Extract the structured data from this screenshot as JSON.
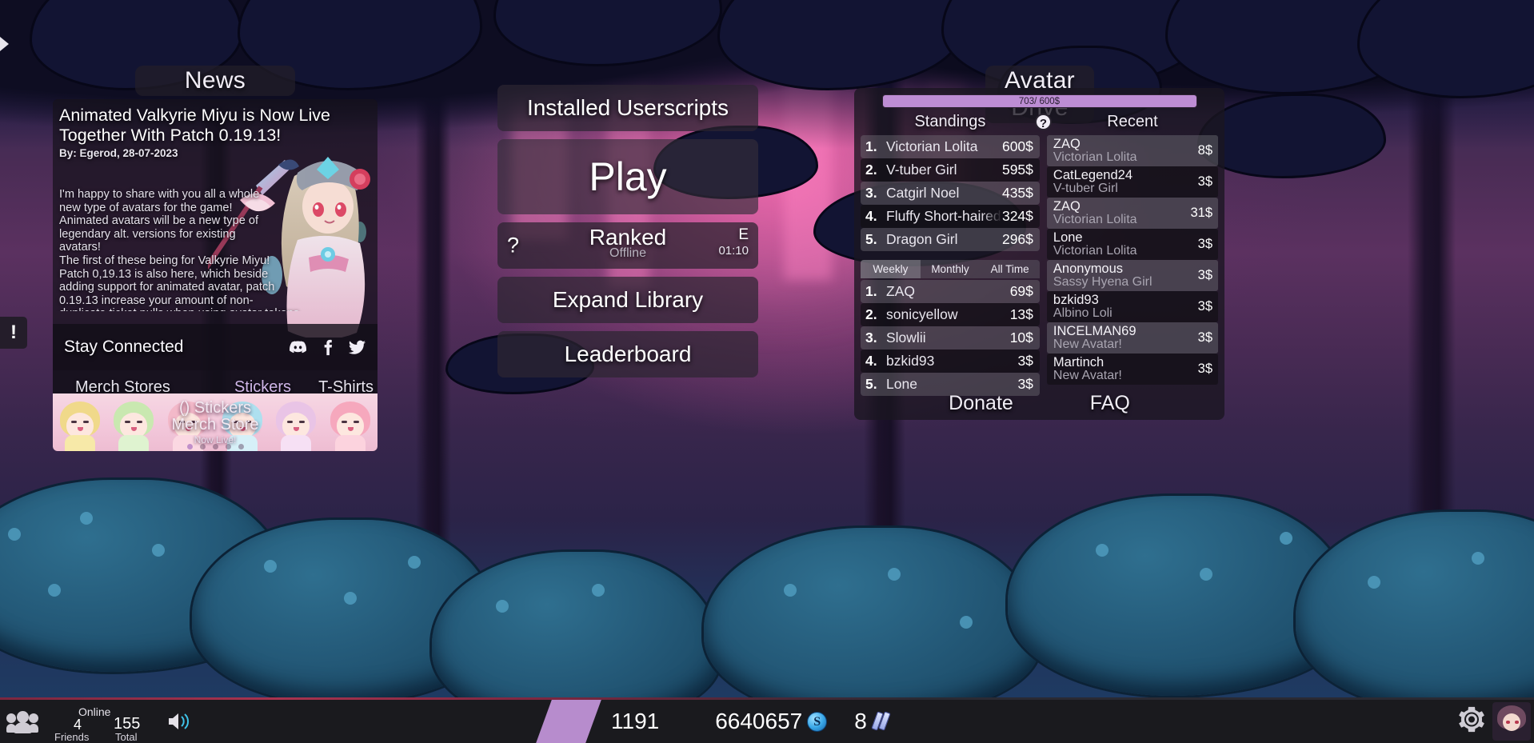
{
  "news": {
    "title": "News",
    "headline": "Animated Valkyrie Miyu is Now Live Together With Patch 0.19.13!",
    "byline": "By: Egerod, 28-07-2023",
    "body": "I'm happy to share with you all a whole\nnew type of avatars for the game!\nAnimated avatars will be a new type of\nlegendary alt. versions for existing\navatars!\nThe first of these being for Valkyrie Miyu!\nPatch 0,19.13 is also here, which beside\nadding support for animated avatar, patch\n0.19.13 increase your amount of non-\nduplicate ticket pulls when using avatar tokens, and make several",
    "stay_connected_label": "Stay Connected",
    "social_icons": [
      "discord-icon",
      "facebook-icon",
      "twitter-icon"
    ],
    "links": [
      {
        "label": "Merch Stores",
        "accent": false
      },
      {
        "label": "Stickers",
        "accent": true
      },
      {
        "label": "T-Shirts",
        "accent": false
      }
    ],
    "banner": {
      "line1": "() Stickers",
      "line2": "Merch Store",
      "line3": "Now Live!",
      "dots": 5,
      "active_dot": 0
    }
  },
  "menu": {
    "userscripts": "Installed Userscripts",
    "play": "Play",
    "ranked": {
      "help": "?",
      "label": "Ranked",
      "status": "Offline",
      "grade": "E",
      "timer": "01:10"
    },
    "expand_library": "Expand Library",
    "leaderboard": "Leaderboard"
  },
  "avatar_drive": {
    "title": "Avatar Drive",
    "progress_label": "703/ 600$",
    "progress_percent": 100,
    "help_icon": "question-mark-icon",
    "standings_header": "Standings",
    "recent_header": "Recent",
    "standings": [
      {
        "rank": "1.",
        "name": "Victorian Lolita",
        "value": "600$"
      },
      {
        "rank": "2.",
        "name": "V-tuber Girl",
        "value": "595$"
      },
      {
        "rank": "3.",
        "name": "Catgirl Noel",
        "value": "435$"
      },
      {
        "rank": "4.",
        "name": "Fluffy Short-haired",
        "value": "324$"
      },
      {
        "rank": "5.",
        "name": "Dragon Girl",
        "value": "296$"
      }
    ],
    "tabs": [
      {
        "label": "Weekly",
        "active": true
      },
      {
        "label": "Monthly",
        "active": false
      },
      {
        "label": "All Time",
        "active": false
      }
    ],
    "donators": [
      {
        "rank": "1.",
        "name": "ZAQ",
        "value": "69$"
      },
      {
        "rank": "2.",
        "name": "sonicyellow",
        "value": "13$"
      },
      {
        "rank": "3.",
        "name": "Slowlii",
        "value": "10$"
      },
      {
        "rank": "4.",
        "name": "bzkid93",
        "value": "3$"
      },
      {
        "rank": "5.",
        "name": "Lone",
        "value": "3$"
      }
    ],
    "recent": [
      {
        "user": "ZAQ",
        "avatar": "Victorian Lolita",
        "amount": "8$"
      },
      {
        "user": "CatLegend24",
        "avatar": "V-tuber Girl",
        "amount": "3$"
      },
      {
        "user": "ZAQ",
        "avatar": "Victorian Lolita",
        "amount": "31$"
      },
      {
        "user": "Lone",
        "avatar": "Victorian Lolita",
        "amount": "3$"
      },
      {
        "user": "Anonymous",
        "avatar": "Sassy Hyena Girl",
        "amount": "3$"
      },
      {
        "user": "bzkid93",
        "avatar": "Albino Loli",
        "amount": "3$"
      },
      {
        "user": "INCELMAN69",
        "avatar": "New Avatar!",
        "amount": "3$"
      },
      {
        "user": "Martinch",
        "avatar": "New Avatar!",
        "amount": "3$"
      }
    ],
    "footer": [
      {
        "label": "Donate"
      },
      {
        "label": "FAQ"
      }
    ]
  },
  "edge": {
    "arrow_icon": "chevron-right-icon",
    "alert_label": "!"
  },
  "bottom_bar": {
    "friends_icon": "people-icon",
    "online_label": "Online",
    "friends_count": "4",
    "friends_label": "Friends",
    "total_count": "155",
    "total_label": "Total",
    "speaker_icon": "speaker-icon",
    "currency_1": "1191",
    "currency_2": "6640657",
    "coin_icon": "soul-coin-icon",
    "currency_3": "8",
    "ticket_icon": "ticket-icon",
    "gear_icon": "gear-icon",
    "avatar_icon": "avatar-thumbnail"
  },
  "colors": {
    "accent": "#b78ccd",
    "progress_fill": "#bd8dd4",
    "link_accent": "#cfb6e8",
    "bar_bg": "#1a1a1e"
  }
}
